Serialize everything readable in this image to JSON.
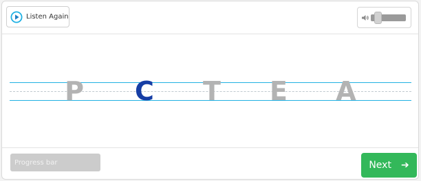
{
  "colors": {
    "accent": "#1fb0e3",
    "active_letter": "#163ea5",
    "inactive_letter": "#b3b3b3",
    "next_button": "#33b85a",
    "progress_bar": "#cccccc"
  },
  "toolbar": {
    "listen_label": "Listen Again",
    "listen_icon": "play-circle-icon",
    "volume_icon": "speaker-icon",
    "volume_level": 0.25
  },
  "letters": [
    {
      "char": "P",
      "state": "inactive"
    },
    {
      "char": "C",
      "state": "active"
    },
    {
      "char": "T",
      "state": "inactive"
    },
    {
      "char": "E",
      "state": "inactive"
    },
    {
      "char": "A",
      "state": "inactive"
    }
  ],
  "footer": {
    "progress_label": "Progress bar",
    "next_label": "Next",
    "next_icon": "arrow-right-icon",
    "next_arrow": "➔"
  }
}
